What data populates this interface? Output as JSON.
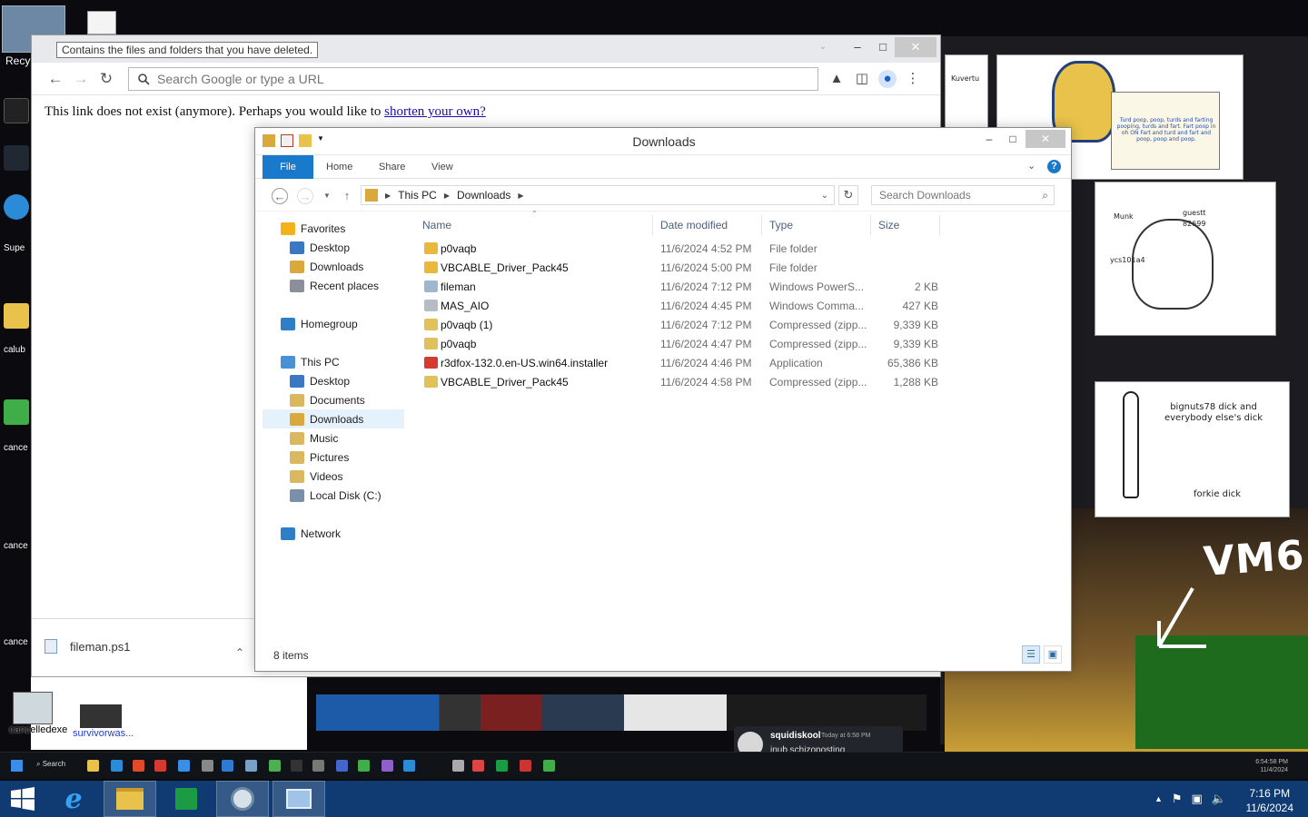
{
  "tooltip": "Contains the files and folders that you have deleted.",
  "chrome": {
    "omnibox_placeholder": "Search Google or type a URL",
    "message_prefix": "This link does not exist (anymore). Perhaps you would like to ",
    "message_link": "shorten your own?",
    "download_item": "fileman.ps1"
  },
  "explorer": {
    "title": "Downloads",
    "ribbon_tabs": [
      "File",
      "Home",
      "Share",
      "View"
    ],
    "breadcrumb": [
      "This PC",
      "Downloads"
    ],
    "search_placeholder": "Search Downloads",
    "columns": [
      "Name",
      "Date modified",
      "Type",
      "Size"
    ],
    "nav": [
      {
        "label": "Favorites",
        "icon": "star-icon",
        "color": "#f2b21b",
        "indent": 0
      },
      {
        "label": "Desktop",
        "icon": "desktop-icon",
        "color": "#3b78c4",
        "indent": 1
      },
      {
        "label": "Downloads",
        "icon": "downloads-folder-icon",
        "color": "#d9a93b",
        "indent": 1
      },
      {
        "label": "Recent places",
        "icon": "recent-places-icon",
        "color": "#8a8f99",
        "indent": 1
      },
      {
        "label": "Homegroup",
        "icon": "homegroup-icon",
        "color": "#2e7fc7",
        "indent": 0
      },
      {
        "label": "This PC",
        "icon": "computer-icon",
        "color": "#4a90d6",
        "indent": 0
      },
      {
        "label": "Desktop",
        "icon": "desktop-icon",
        "color": "#3b78c4",
        "indent": 1
      },
      {
        "label": "Documents",
        "icon": "documents-icon",
        "color": "#d9b860",
        "indent": 1
      },
      {
        "label": "Downloads",
        "icon": "downloads-folder-icon",
        "color": "#d9a93b",
        "indent": 1
      },
      {
        "label": "Music",
        "icon": "music-icon",
        "color": "#d9b860",
        "indent": 1
      },
      {
        "label": "Pictures",
        "icon": "pictures-icon",
        "color": "#d9b860",
        "indent": 1
      },
      {
        "label": "Videos",
        "icon": "videos-icon",
        "color": "#d9b860",
        "indent": 1
      },
      {
        "label": "Local Disk (C:)",
        "icon": "drive-icon",
        "color": "#7a8fa8",
        "indent": 1
      },
      {
        "label": "Network",
        "icon": "network-icon",
        "color": "#2e7fc7",
        "indent": 0
      }
    ],
    "files": [
      {
        "name": "p0vaqb",
        "date": "11/6/2024 4:52 PM",
        "type": "File folder",
        "size": "",
        "icon": "folder-icon",
        "color": "#e8b93c"
      },
      {
        "name": "VBCABLE_Driver_Pack45",
        "date": "11/6/2024 5:00 PM",
        "type": "File folder",
        "size": "",
        "icon": "folder-icon",
        "color": "#e8b93c"
      },
      {
        "name": "fileman",
        "date": "11/6/2024 7:12 PM",
        "type": "Windows PowerS...",
        "size": "2 KB",
        "icon": "powershell-script-icon",
        "color": "#9fb6cf"
      },
      {
        "name": "MAS_AIO",
        "date": "11/6/2024 4:45 PM",
        "type": "Windows Comma...",
        "size": "427 KB",
        "icon": "cmd-script-icon",
        "color": "#b5bcc6"
      },
      {
        "name": "p0vaqb (1)",
        "date": "11/6/2024 7:12 PM",
        "type": "Compressed (zipp...",
        "size": "9,339 KB",
        "icon": "zip-folder-icon",
        "color": "#e2c15a"
      },
      {
        "name": "p0vaqb",
        "date": "11/6/2024 4:47 PM",
        "type": "Compressed (zipp...",
        "size": "9,339 KB",
        "icon": "zip-folder-icon",
        "color": "#e2c15a"
      },
      {
        "name": "r3dfox-132.0.en-US.win64.installer",
        "date": "11/6/2024 4:46 PM",
        "type": "Application",
        "size": "65,386 KB",
        "icon": "installer-icon",
        "color": "#d43a2f"
      },
      {
        "name": "VBCABLE_Driver_Pack45",
        "date": "11/6/2024 4:58 PM",
        "type": "Compressed (zipp...",
        "size": "1,288 KB",
        "icon": "zip-folder-icon",
        "color": "#e2c15a"
      }
    ],
    "item_count": "8 items"
  },
  "desktop_icons": [
    "Recy",
    "cancelledexe",
    "survivorwas..."
  ],
  "desktop_side_labels": [
    "calub",
    "cance",
    "cance",
    "cance",
    "Supe"
  ],
  "sketches": {
    "poop_text": "Turd poop, poop, turds and farting pooping, turds and fart. Fart poop in oh ON Fart and turd and fart and poop, poop and poop.",
    "guest_label": "guestt 82699",
    "munk_label": "Munk",
    "ycs_label": "ycs101a4",
    "dick_caption": "bignuts78 dick and everybody else's dick",
    "forkie_caption": "forkie dick",
    "vm6": "VM6",
    "kuvertu": "Kuvertu"
  },
  "chat_popup": {
    "user": "squidiskool",
    "time": "Today at 6:58 PM",
    "message": "inub schizoposting"
  },
  "vm_taskbar": {
    "search": "Search",
    "clock_time": "6:54:58 PM",
    "clock_date": "11/4/2024"
  },
  "host_clock": {
    "time": "7:16 PM",
    "date": "11/6/2024"
  }
}
